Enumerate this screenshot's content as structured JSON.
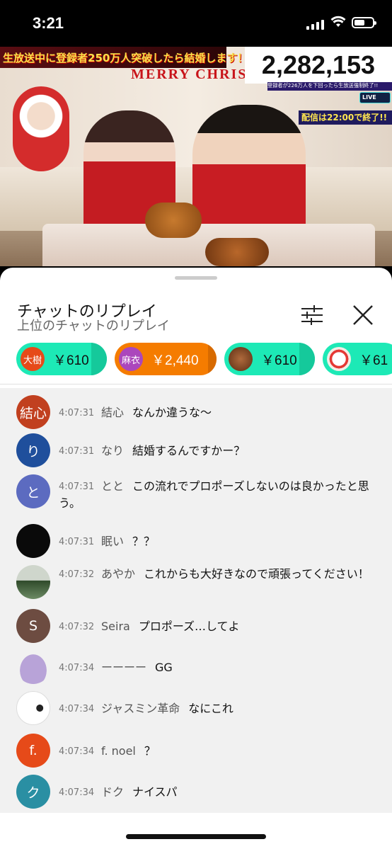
{
  "status": {
    "time": "3:21"
  },
  "video": {
    "banner": "生放送中に登録者250万人突破したら結婚します！",
    "counter": "2,282,153",
    "subcaption": "登録者が226万人を下回ったら生放送強制終了!!",
    "live": "LIVE",
    "endcaption": "配信は22:00で終了!!",
    "garland": "MERRY CHRIST"
  },
  "panel": {
    "title": "チャットのリプレイ",
    "subtitle": "上位のチャットのリプレイ",
    "filter_icon": "tune-sliders-icon",
    "close_icon": "close-x-icon"
  },
  "superchats": [
    {
      "avatar_text": "大樹",
      "amount": "￥610",
      "bg": "#1de9b6",
      "avatar_bg": "#e64a19"
    },
    {
      "avatar_text": "麻衣",
      "amount": "￥2,440",
      "bg": "#f57c00",
      "avatar_bg": "#ab47bc"
    },
    {
      "avatar_text": "",
      "amount": "￥610",
      "bg": "#1de9b6",
      "avatar_bg": "#8d5a3b"
    },
    {
      "avatar_text": "",
      "amount": "￥61",
      "bg": "#1de9b6",
      "avatar_bg": "#f2ede6"
    }
  ],
  "messages": [
    {
      "avatar": "結心",
      "avatar_bg": "#c1401f",
      "time": "4:07:31",
      "author": "結心",
      "text": "なんか違うな〜"
    },
    {
      "avatar": "り",
      "avatar_bg": "#1f4f9c",
      "time": "4:07:31",
      "author": "なり",
      "text": "結婚するんですかー？"
    },
    {
      "avatar": "と",
      "avatar_bg": "#5c6bc0",
      "time": "4:07:31",
      "author": "とと",
      "text": "この流れでプロポーズしないのは良かったと思う。"
    },
    {
      "avatar": "",
      "avatar_bg": "#0a0a0a",
      "time": "4:07:31",
      "author": "眠い",
      "text": "？？"
    },
    {
      "avatar": "",
      "avatar_bg": "#5b6b55",
      "time": "4:07:32",
      "author": "あやか",
      "text": "これからも大好きなので頑張ってください！"
    },
    {
      "avatar": "S",
      "avatar_bg": "#6d4c41",
      "time": "4:07:32",
      "author": "Seira",
      "text": "プロポーズ…してよ"
    },
    {
      "avatar": "",
      "avatar_bg": "#b8a3d8",
      "time": "4:07:34",
      "author": "ーーーー",
      "text": "GG"
    },
    {
      "avatar": "",
      "avatar_bg": "#ffffff",
      "time": "4:07:34",
      "author": "ジャスミン革命",
      "text": "なにこれ"
    },
    {
      "avatar": "f.",
      "avatar_bg": "#e64a19",
      "time": "4:07:34",
      "author": "f. noel",
      "text": "？"
    },
    {
      "avatar": "ク",
      "avatar_bg": "#2a8fa3",
      "time": "4:07:34",
      "author": "ドク",
      "text": "ナイスパ"
    }
  ]
}
